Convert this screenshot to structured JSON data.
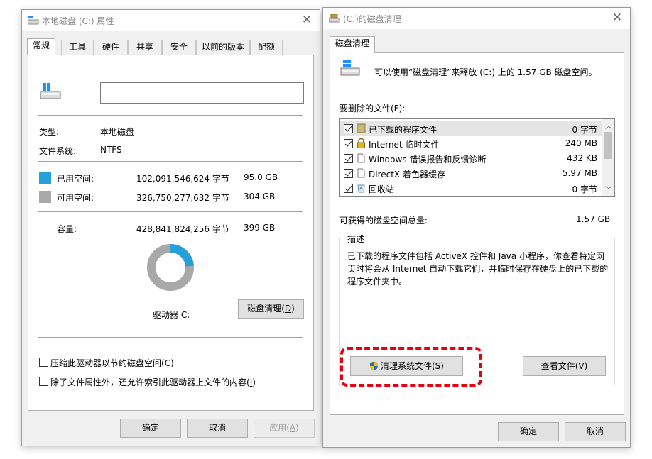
{
  "left_window": {
    "title": "本地磁盘 (C:) 属性",
    "tabs": [
      "常规",
      "工具",
      "硬件",
      "共享",
      "安全",
      "以前的版本",
      "配额"
    ],
    "name_field_value": "",
    "type_label": "类型:",
    "type_value": "本地磁盘",
    "fs_label": "文件系统:",
    "fs_value": "NTFS",
    "used_label": "已用空间:",
    "used_bytes": "102,091,546,624 字节",
    "used_size": "95.0 GB",
    "free_label": "可用空间:",
    "free_bytes": "326,750,277,632 字节",
    "free_size": "304 GB",
    "capacity_label": "容量:",
    "capacity_bytes": "428,841,824,256 字节",
    "capacity_size": "399 GB",
    "used_fraction": 0.238,
    "used_color": "#26a0da",
    "free_color": "#a8a8a8",
    "drive_label": "驱动器 C:",
    "cleanup_button": "磁盘清理(",
    "cleanup_key": "D",
    "compress_label": "压缩此驱动器以节约磁盘空间(",
    "compress_key": "C",
    "index_label": "除了文件属性外，还允许索引此驱动器上文件的内容(",
    "index_key": "I",
    "ok": "确定",
    "cancel": "取消",
    "apply": "应用(",
    "apply_key": "A"
  },
  "right_window": {
    "title": "(C:)的磁盘清理",
    "tab": "磁盘清理",
    "header_text": "可以使用“磁盘清理”来释放  (C:) 上的 1.57 GB 磁盘空间。",
    "files_label": "要删除的文件(F):",
    "files": [
      {
        "name": "已下载的程序文件",
        "size": "0 字节",
        "checked": true,
        "icon": "folder-icon"
      },
      {
        "name": "Internet 临时文件",
        "size": "240 MB",
        "checked": true,
        "icon": "lock-icon"
      },
      {
        "name": "Windows 错误报告和反馈诊断",
        "size": "432 KB",
        "checked": true,
        "icon": "file-icon"
      },
      {
        "name": "DirectX 着色器缓存",
        "size": "5.97 MB",
        "checked": true,
        "icon": "file-icon"
      },
      {
        "name": "回收站",
        "size": "0 字节",
        "checked": true,
        "icon": "recycle-bin-icon"
      }
    ],
    "total_label": "可获得的磁盘空间总量:",
    "total_value": "1.57 GB",
    "desc_title": "描述",
    "desc_text": "已下载的程序文件包括 ActiveX 控件和 Java 小程序，你查看特定网页时将会从 Internet 自动下载它们，并临时保存在硬盘上的已下载的程序文件夹中。",
    "clean_system_button": "清理系统文件(S)",
    "view_files_button": "查看文件(V)",
    "ok": "确定",
    "cancel": "取消",
    "highlight_color": "#e60012"
  }
}
